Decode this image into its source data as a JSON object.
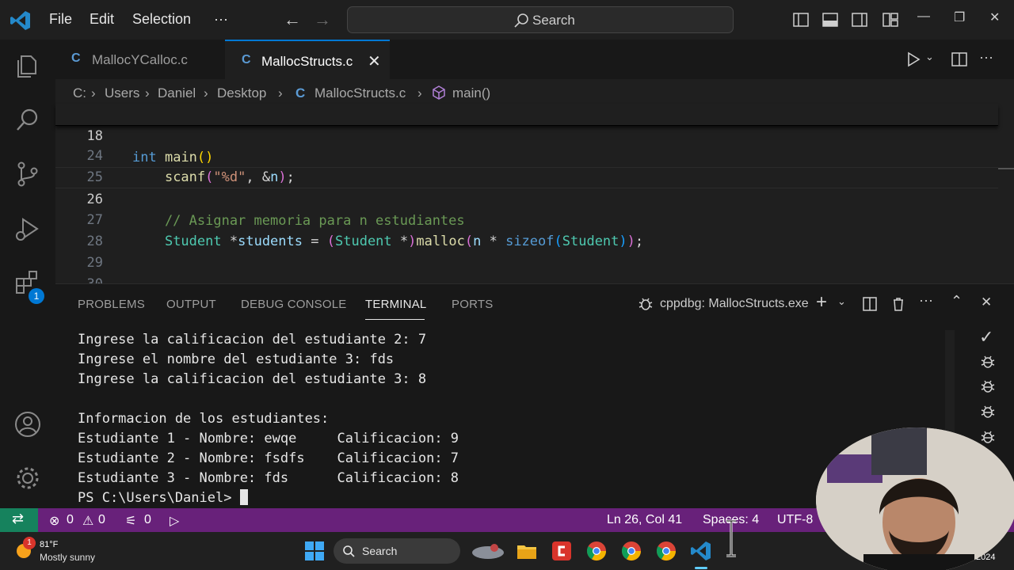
{
  "titlebar": {
    "menu": [
      "File",
      "Edit",
      "Selection",
      "···"
    ],
    "search_label": "Search"
  },
  "activity_badge": "1",
  "tabs": [
    {
      "label": "MallocYCalloc.c",
      "active": false
    },
    {
      "label": "MallocStructs.c",
      "active": true
    }
  ],
  "breadcrumb": [
    "C:",
    "Users",
    "Daniel",
    "Desktop",
    "MallocStructs.c",
    "main()"
  ],
  "editor": {
    "sticky": {
      "line": "18",
      "code": "int main()"
    },
    "lines": [
      {
        "n": "24",
        "code": "    scanf(\"%d\", &n);"
      },
      {
        "n": "25",
        "code": ""
      },
      {
        "n": "26",
        "code": "    // Asignar memoria para n estudiantes"
      },
      {
        "n": "27",
        "code": "    Student *students = (Student *)malloc(n * sizeof(Student));"
      },
      {
        "n": "28",
        "code": ""
      },
      {
        "n": "29",
        "code": ""
      },
      {
        "n": "30",
        "code": ""
      }
    ],
    "active_line": "26"
  },
  "panel": {
    "tabs": [
      "PROBLEMS",
      "OUTPUT",
      "DEBUG CONSOLE",
      "TERMINAL",
      "PORTS"
    ],
    "active_tab": "TERMINAL",
    "terminal_name": "cppdbg: MallocStructs.exe",
    "terminal_lines": [
      "Ingrese la calificacion del estudiante 2: 7",
      "Ingrese el nombre del estudiante 3: fds",
      "Ingrese la calificacion del estudiante 3: 8",
      "",
      "Informacion de los estudiantes:",
      "Estudiante 1 - Nombre: ewqe     Calificacion: 9",
      "Estudiante 2 - Nombre: fsdfs    Calificacion: 7",
      "Estudiante 3 - Nombre: fds      Calificacion: 8",
      "PS C:\\Users\\Daniel> "
    ]
  },
  "statusbar": {
    "errors": "0",
    "warnings": "0",
    "ports": "0",
    "position": "Ln 26, Col 41",
    "spaces": "Spaces: 4",
    "encoding": "UTF-8"
  },
  "taskbar": {
    "weather_temp": "81°F",
    "weather_desc": "Mostly sunny",
    "weather_badge": "1",
    "search_label": "Search",
    "year": "2024"
  },
  "colors": {
    "statusbar": "#68217a",
    "remote": "#16825d",
    "accent": "#0078d4"
  }
}
